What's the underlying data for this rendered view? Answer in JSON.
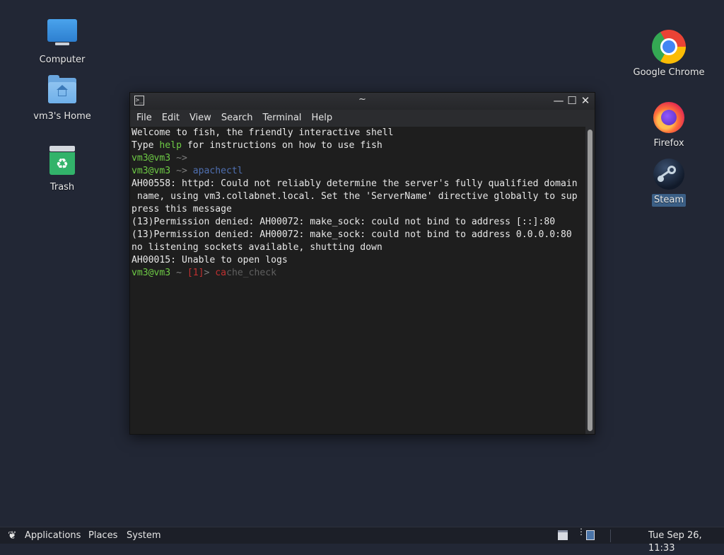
{
  "desktop": {
    "icons_left": [
      {
        "label": "Computer",
        "icon": "computer-icon"
      },
      {
        "label": "vm3's Home",
        "icon": "home-folder-icon"
      },
      {
        "label": "Trash",
        "icon": "trash-icon"
      }
    ],
    "icons_right": [
      {
        "label": "Google Chrome",
        "icon": "chrome-icon"
      },
      {
        "label": "Firefox",
        "icon": "firefox-icon"
      },
      {
        "label": "Steam",
        "icon": "steam-icon"
      }
    ]
  },
  "terminal": {
    "title": "~",
    "title_icon": ">_",
    "window_buttons": {
      "minimize": "—",
      "maximize": "☐",
      "close": "✕"
    },
    "menu": [
      "File",
      "Edit",
      "View",
      "Search",
      "Terminal",
      "Help"
    ],
    "lines": {
      "l1": "Welcome to fish, the friendly interactive shell",
      "l2_a": "Type ",
      "l2_b": "help",
      "l2_c": " for instructions on how to use fish",
      "l3_user": "vm3@vm3",
      "l3_rest": " ~>",
      "l4_user": "vm3@vm3",
      "l4_prompt": " ~> ",
      "l4_cmd": "apachectl",
      "l5": "AH00558: httpd: Could not reliably determine the server's fully qualified domain",
      "l6": " name, using vm3.collabnet.local. Set the 'ServerName' directive globally to sup",
      "l7": "press this message",
      "l8": "(13)Permission denied: AH00072: make_sock: could not bind to address [::]:80",
      "l9": "(13)Permission denied: AH00072: make_sock: could not bind to address 0.0.0.0:80",
      "l10": "no listening sockets available, shutting down",
      "l11": "AH00015: Unable to open logs",
      "l12_user": "vm3@vm3",
      "l12_tilde": " ~ ",
      "l12_status": "[1]",
      "l12_arrow": "> ",
      "l12_typed": "ca",
      "l12_suggestion": "che_check"
    },
    "colors": {
      "prompt_user": "#6ecb45",
      "command": "#4f6fb0",
      "error_status": "#c03030",
      "autosuggestion": "#606060"
    }
  },
  "panel": {
    "applications": "Applications",
    "places": "Places",
    "system": "System",
    "clock": "Tue Sep 26, 11:33"
  }
}
